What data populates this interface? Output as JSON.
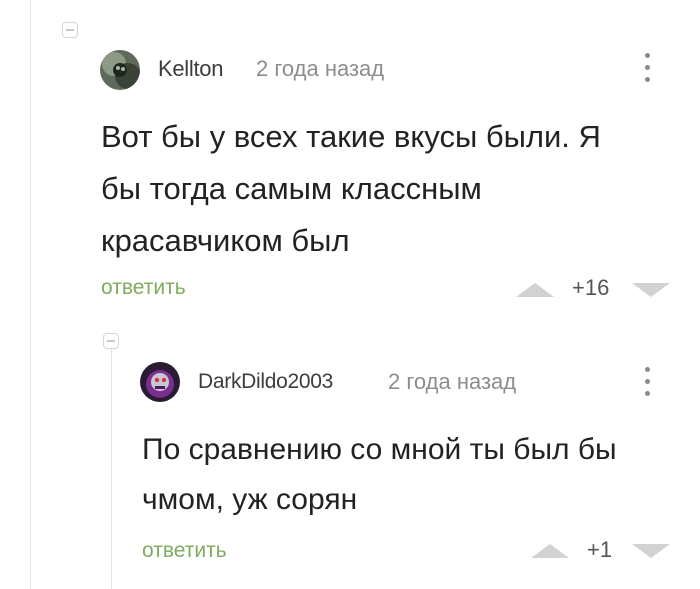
{
  "comments": [
    {
      "author": "Kellton",
      "time": "2 года назад",
      "text_lines": [
        "Вот бы у всех такие вкусы были. Я",
        "бы тогда самым классным",
        "красавчиком был"
      ],
      "reply_label": "ответить",
      "rating": "+16"
    },
    {
      "author": "DarkDildo2003",
      "time": "2 года назад",
      "text_lines": [
        "По сравнению со мной ты был бы",
        "чмом, уж сорян"
      ],
      "reply_label": "ответить",
      "rating": "+1"
    }
  ],
  "colors": {
    "reply": "#7fab5e",
    "thread_line": "#e3e3e3",
    "vote_arrow": "#d2d2d2"
  }
}
